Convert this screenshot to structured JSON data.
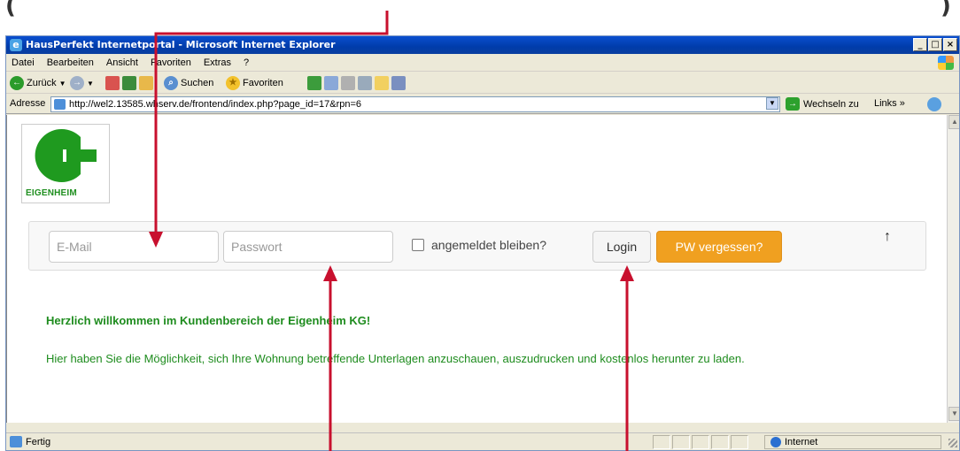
{
  "browser": {
    "title": "HausPerfekt Internetportal - Microsoft Internet Explorer",
    "menu": [
      "Datei",
      "Bearbeiten",
      "Ansicht",
      "Favoriten",
      "Extras",
      "?"
    ],
    "toolbar": {
      "back": "Zurück",
      "search": "Suchen",
      "favorites": "Favoriten"
    },
    "address": {
      "label": "Adresse",
      "url": "http://wel2.13585.whserv.de/frontend/index.php?page_id=17&rpn=6",
      "go": "Wechseln zu",
      "links": "Links"
    },
    "status": {
      "text": "Fertig",
      "zone": "Internet"
    }
  },
  "page": {
    "logo_text": "EIGENHEIM",
    "email_placeholder": "E-Mail",
    "password_placeholder": "Passwort",
    "remember_label": "angemeldet bleiben?",
    "login_button": "Login",
    "forgot_button": "PW vergessen?",
    "up_arrow": "↑",
    "welcome": "Herzlich willkommen im Kundenbereich der Eigenheim KG!",
    "info": "Hier haben Sie die Möglichkeit, sich Ihre Wohnung betreffende Unterlagen anzuschauen, auszudrucken und kostenlos herunter zu laden."
  },
  "colors": {
    "accent_green": "#1e8c1e",
    "forgot_orange": "#f0a020",
    "annotation_red": "#c8102e"
  }
}
